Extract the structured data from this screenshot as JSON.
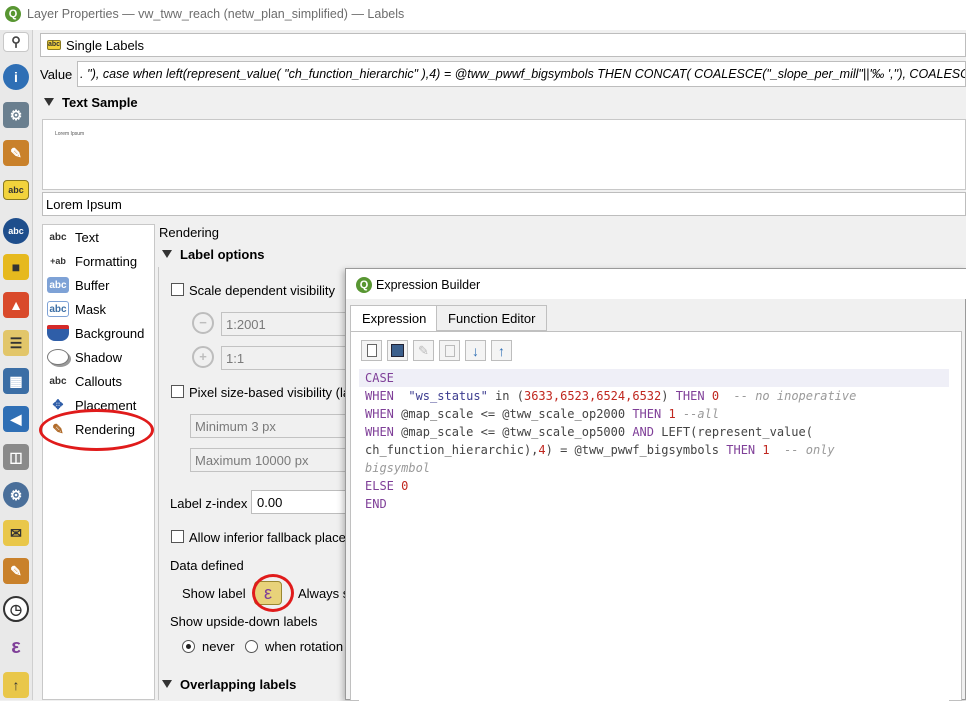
{
  "window": {
    "title": "Layer Properties — vw_tww_reach (netw_plan_simplified) — Labels"
  },
  "left_strip": {
    "icons": [
      "search-icon",
      "information-icon",
      "source-icon",
      "symbology-icon",
      "labels-icon",
      "abc-icon",
      "3d-view-icon",
      "diagrams-icon",
      "fields-icon",
      "attributes-form-icon",
      "joins-icon",
      "auxiliary-storage-icon",
      "actions-icon",
      "display-icon",
      "rendering-icon",
      "temporal-icon",
      "variables-icon",
      "metadata-icon"
    ]
  },
  "mode": {
    "label": "Single Labels"
  },
  "value": {
    "label": "Value",
    "text": ". ''), case when left(represent_value( \"ch_function_hierarchic\" ),4) = @tww_pwwf_bigsymbols THEN CONCAT( COALESCE(\"_slope_per_mill\"||'‰  ',''), COALESCE(\"width\" , '') || '…"
  },
  "text_sample": {
    "heading": "Text Sample",
    "mini_text": "Lorem Ipsum",
    "input_value": "Lorem Ipsum"
  },
  "prop_list": {
    "items": [
      {
        "label": "Text",
        "icon": "abc"
      },
      {
        "label": "Formatting",
        "icon": "+ab/c"
      },
      {
        "label": "Buffer",
        "icon": "abc"
      },
      {
        "label": "Mask",
        "icon": "abc"
      },
      {
        "label": "Background",
        "icon": "shield"
      },
      {
        "label": "Shadow",
        "icon": "shadow"
      },
      {
        "label": "Callouts",
        "icon": "abc"
      },
      {
        "label": "Placement",
        "icon": "arrows"
      },
      {
        "label": "Rendering",
        "icon": "brush"
      }
    ]
  },
  "rendering": {
    "title": "Rendering",
    "label_options": "Label options",
    "scale_dependent": "Scale dependent visibility",
    "min_scale": "1:2001",
    "max_scale": "1:1",
    "pixel_size": "Pixel size-based visibility (la",
    "min_px": "Minimum 3 px",
    "max_px": "Maximum 10000 px",
    "z_index_label": "Label z-index",
    "z_index_value": "0.00",
    "fallback": "Allow inferior fallback place",
    "data_defined": "Data defined",
    "show_label": "Show label",
    "always_show": "Always s",
    "upside_down": "Show upside-down labels",
    "never": "never",
    "when_rotation": "when rotation",
    "overlapping": "Overlapping labels"
  },
  "expression_builder": {
    "title": "Expression Builder",
    "tabs": [
      "Expression",
      "Function Editor"
    ],
    "toolbar": [
      "new-file-icon",
      "save-icon",
      "edit-icon",
      "delete-icon",
      "import-icon",
      "export-icon"
    ],
    "code": {
      "l1_kw": "CASE",
      "l2_kw": "WHEN",
      "l2_field": "\"ws_status\"",
      "l2_in": " in (",
      "l2_nums": "3633,6523,6524,6532",
      "l2_close": ") ",
      "l2_then": "THEN",
      "l2_zero": "0",
      "l2_cmt": "-- no inoperative",
      "l3_kw": "WHEN",
      "l3_a": " @map_scale <= @tww_scale_op2000 ",
      "l3_then": "THEN",
      "l3_one": "1",
      "l3_cmt": "--all",
      "l4_kw": "WHEN",
      "l4_a": " @map_scale <= @tww_scale_op5000 ",
      "l4_and": "AND",
      "l4_b": " LEFT(represent_value(",
      "l5_a": "ch_function_hierarchic),",
      "l5_four": "4",
      "l5_b": ") = @tww_pwwf_bigsymbols ",
      "l5_then": "THEN",
      "l5_one": "1",
      "l5_cmt": "-- only",
      "l6_cmt": "bigsymbol",
      "l7_kw": "ELSE",
      "l7_zero": "0",
      "l8_kw": "END"
    }
  },
  "colors": {
    "highlight_red": "#e01b1b",
    "qgis_green": "#589632",
    "keyword_purple": "#7f3f98"
  }
}
